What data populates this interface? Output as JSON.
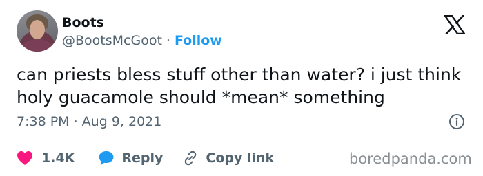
{
  "author": {
    "name": "Boots",
    "handle": "@BootsMcGoot",
    "separator": "·",
    "follow_label": "Follow"
  },
  "tweet": {
    "text": "can priests bless stuff other than water? i just think holy guacamole should *mean* something",
    "timestamp": "7:38 PM · Aug 9, 2021"
  },
  "actions": {
    "likes": "1.4K",
    "reply_label": "Reply",
    "copy_link_label": "Copy link"
  },
  "watermark": "boredpanda.com",
  "colors": {
    "link_blue": "#1d9bf0",
    "like_red": "#f91880",
    "secondary_text": "#536471",
    "primary_text": "#0f1419"
  },
  "icons": [
    "x-logo-icon",
    "info-icon",
    "heart-icon",
    "reply-bubble-icon",
    "link-icon"
  ]
}
